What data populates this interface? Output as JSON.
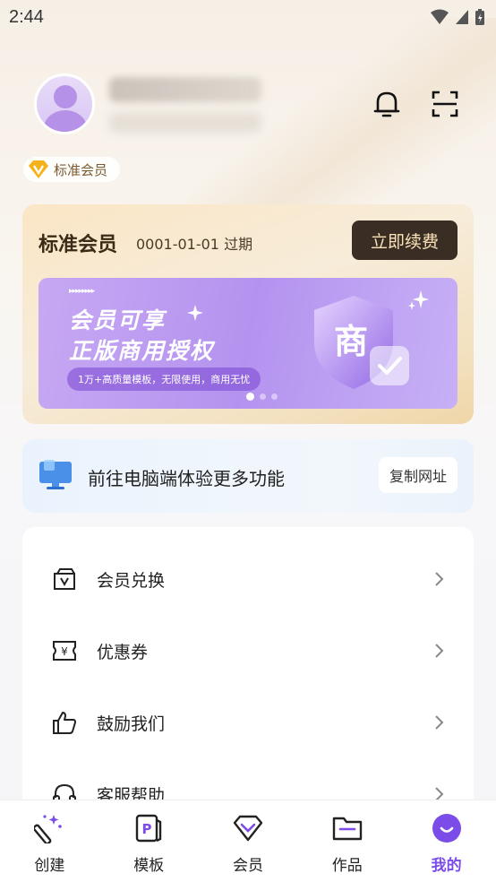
{
  "status_bar": {
    "time": "2:44"
  },
  "profile": {
    "member_tag": "标准会员"
  },
  "vip_card": {
    "title": "标准会员",
    "expire_date": "0001-01-01",
    "expire_suffix": "过期",
    "renew_label": "立即续费",
    "banner": {
      "line1": "会员可享",
      "line2": "正版商用授权",
      "pill_text": "1万+高质量模板，无限使用，商用无忧",
      "shield_char": "商"
    }
  },
  "pc_card": {
    "text": "前往电脑端体验更多功能",
    "copy_label": "复制网址"
  },
  "menu": {
    "items": [
      {
        "label": "会员兑换",
        "icon": "gift-bag-icon"
      },
      {
        "label": "优惠券",
        "icon": "coupon-icon"
      },
      {
        "label": "鼓励我们",
        "icon": "thumbs-up-icon"
      },
      {
        "label": "客服帮助",
        "icon": "headset-icon"
      }
    ]
  },
  "bottom_nav": {
    "items": [
      {
        "label": "创建",
        "icon": "magic-wand-icon"
      },
      {
        "label": "模板",
        "icon": "template-icon"
      },
      {
        "label": "会员",
        "icon": "diamond-icon"
      },
      {
        "label": "作品",
        "icon": "folder-icon"
      },
      {
        "label": "我的",
        "icon": "profile-icon",
        "active": true
      }
    ]
  },
  "colors": {
    "accent": "#7b4ce8",
    "renew_bg": "#3a2e24",
    "gold_text": "#fbe2b8"
  }
}
